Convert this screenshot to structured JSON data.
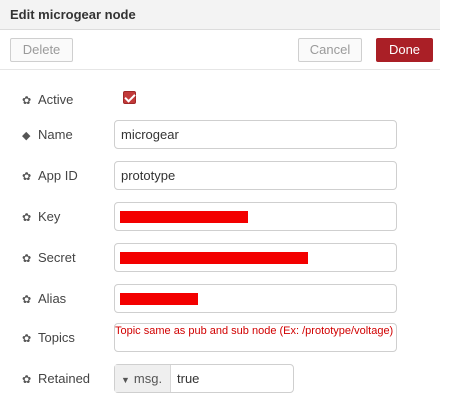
{
  "dialog": {
    "title": "Edit microgear node",
    "buttons": {
      "delete": "Delete",
      "cancel": "Cancel",
      "done": "Done"
    },
    "accent_color": "#aa1f26"
  },
  "fields": {
    "active": {
      "label": "Active",
      "icon": "cog-icon",
      "checked": true
    },
    "name": {
      "label": "Name",
      "icon": "tag-icon",
      "value": "microgear"
    },
    "app_id": {
      "label": "App ID",
      "icon": "cog-icon",
      "value": "prototype"
    },
    "key": {
      "label": "Key",
      "icon": "cog-icon",
      "redacted": true
    },
    "secret": {
      "label": "Secret",
      "icon": "cog-icon",
      "redacted": true
    },
    "alias": {
      "label": "Alias",
      "icon": "cog-icon",
      "redacted": true
    },
    "topics": {
      "label": "Topics",
      "icon": "cog-icon",
      "note": "Topic same as pub and sub node (Ex: /prototype/voltage)"
    },
    "retained": {
      "label": "Retained",
      "icon": "cog-icon",
      "type_label": "msg.",
      "value": "true"
    }
  }
}
